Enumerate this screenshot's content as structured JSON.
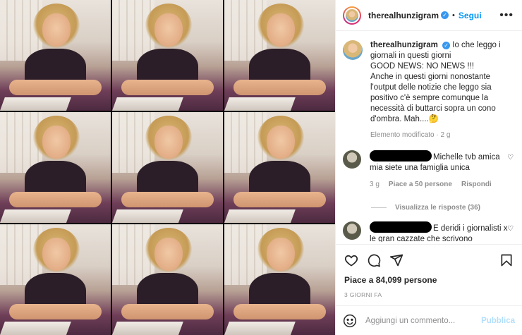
{
  "header": {
    "username": "therealhunzigram",
    "verified_glyph": "✓",
    "separator": "•",
    "follow_label": "Segui",
    "more_glyph": "•••"
  },
  "caption": {
    "username": "therealhunzigram",
    "text_lines": [
      "Io che leggo i giornali in questi giorni",
      "GOOD NEWS: NO NEWS !!!",
      "Anche in questi giorni nonostante l'output delle notizie che leggo sia positivo c'è sempre comunque la necessità di buttarci sopra un cono d'ombra. Mah....🤔"
    ],
    "meta": "Elemento modificato · 2 g"
  },
  "comments": [
    {
      "text": "Michelle tvb amica mia siete una famiglia unica",
      "age": "3 g",
      "likes": "Piace a 50 persone",
      "reply": "Rispondi"
    },
    {
      "text": "E deridi i giornalisti x le gran cazzate che scrivono"
    }
  ],
  "view_replies": "Visualizza le risposte (36)",
  "likes": "Piace a 84,099 persone",
  "date": "3 GIORNI FA",
  "add_comment": {
    "placeholder": "Aggiungi un commento...",
    "publish_label": "Pubblica"
  },
  "icons": [
    "heart-icon",
    "comment-icon",
    "share-icon",
    "bookmark-icon",
    "emoji-icon",
    "more-icon",
    "verified-icon"
  ],
  "colors": {
    "accent": "#0095f6",
    "verified": "#3897f0",
    "publish_disabled": "#b2dffc",
    "muted": "#8e8e8e"
  }
}
